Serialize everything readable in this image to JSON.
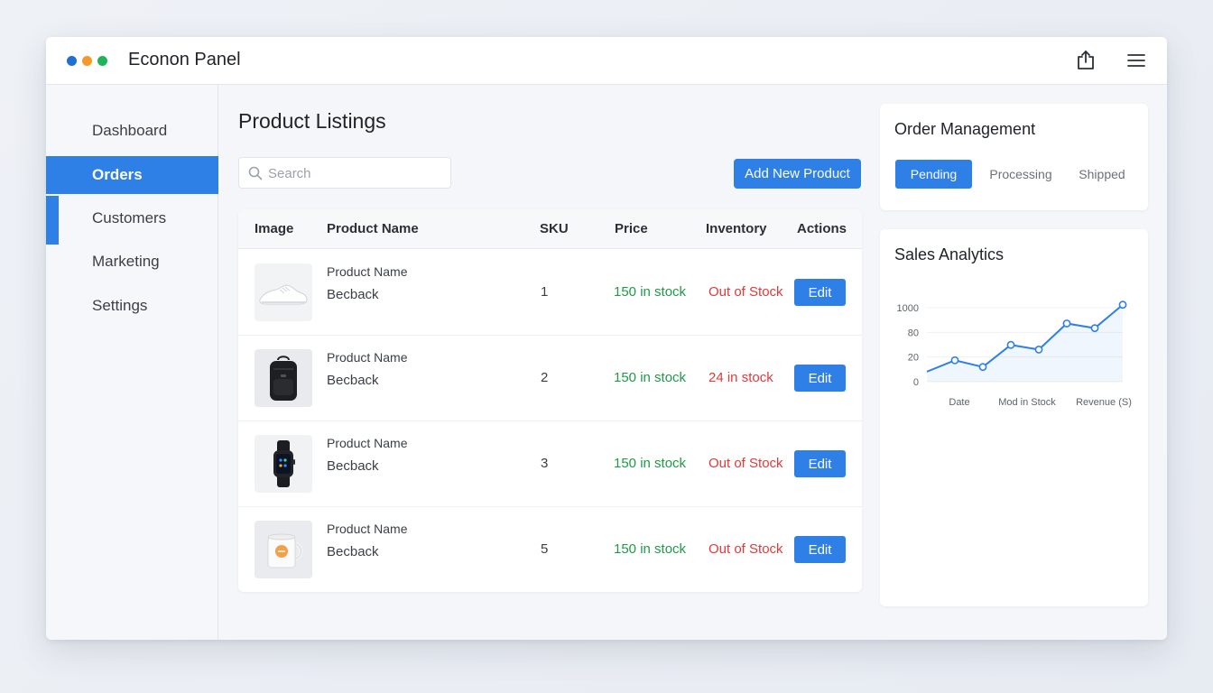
{
  "window": {
    "title": "Econon Panel",
    "dot_colors": [
      "#1f6fd1",
      "#f39a2b",
      "#22b35a"
    ]
  },
  "header_icons": [
    "share-icon",
    "hamburger-menu-icon"
  ],
  "sidebar": {
    "items": [
      {
        "label": "Dashboard",
        "active": false
      },
      {
        "label": "Orders",
        "active": true
      },
      {
        "label": "Customers",
        "active": false
      },
      {
        "label": "Marketing",
        "active": false
      },
      {
        "label": "Settings",
        "active": false
      }
    ]
  },
  "main": {
    "title": "Product Listings",
    "search_placeholder": "Search",
    "add_button": "Add New Product",
    "columns": [
      "Image",
      "Product Name",
      "SKU",
      "Price",
      "Inventory",
      "Actions"
    ],
    "rows": [
      {
        "image": "sneaker",
        "name": "Product Name",
        "subname": "Becback",
        "sku": "1",
        "price": "150 in stock",
        "inventory": "Out of Stock",
        "action": "Edit"
      },
      {
        "image": "backpack",
        "name": "Product Name",
        "subname": "Becback",
        "sku": "2",
        "price": "150 in stock",
        "inventory": "24  in stock",
        "action": "Edit"
      },
      {
        "image": "smartwatch",
        "name": "Product Name",
        "subname": "Becback",
        "sku": "3",
        "price": "150 in stock",
        "inventory": "Out of Stock",
        "action": "Edit"
      },
      {
        "image": "mug",
        "name": "Product Name",
        "subname": "Becback",
        "sku": "5",
        "price": "150 in stock",
        "inventory": "Out of Stock",
        "action": "Edit"
      }
    ]
  },
  "order_management": {
    "title": "Order Management",
    "tabs": [
      {
        "label": "Pending",
        "active": true
      },
      {
        "label": "Processing",
        "active": false
      },
      {
        "label": "Shipped",
        "active": false
      }
    ]
  },
  "sales_analytics": {
    "title": "Sales Analytics",
    "chart_data": {
      "type": "line",
      "y_tick_labels": [
        "1000",
        "80",
        "20",
        "0"
      ],
      "x_tick_labels": [
        "Date",
        "Mod in Stock",
        "Revenue (S)"
      ],
      "values": [
        0.15,
        0.32,
        0.22,
        0.55,
        0.48,
        0.87,
        0.8,
        1.15
      ],
      "ylim": [
        0,
        1.2
      ],
      "series_color": "#2e7fe6"
    }
  },
  "colors": {
    "accent": "#2e7fe6",
    "in_stock": "#1f9a45",
    "out_of_stock": "#e03a3a"
  }
}
